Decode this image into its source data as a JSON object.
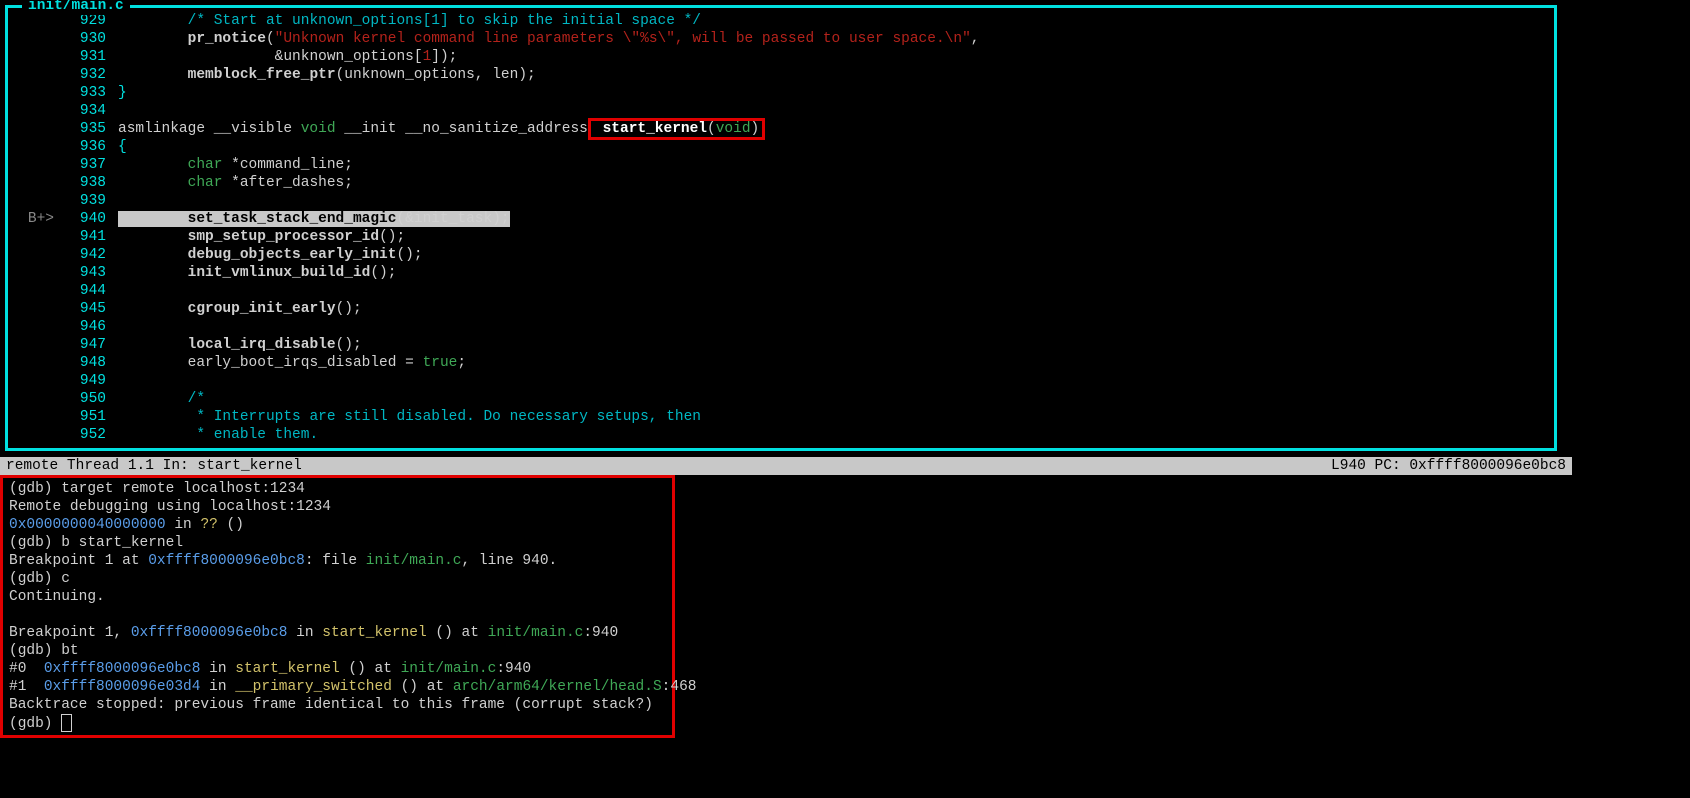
{
  "frame_title": "init/main.c",
  "src": [
    {
      "g": "",
      "n": "929",
      "tokens": [
        [
          "sp",
          "        "
        ],
        [
          "cmt",
          "/* Start at unknown_options[1] to skip the initial space */"
        ]
      ]
    },
    {
      "g": "",
      "n": "930",
      "tokens": [
        [
          "sp",
          "        "
        ],
        [
          "fn",
          "pr_notice"
        ],
        [
          "p",
          "("
        ],
        [
          "str",
          "\"Unknown kernel command line parameters \\\"%s\\\", will be passed to user space.\\n\""
        ],
        [
          "p",
          ","
        ]
      ]
    },
    {
      "g": "",
      "n": "931",
      "tokens": [
        [
          "sp",
          "                  "
        ],
        [
          "p",
          "&"
        ],
        [
          "id",
          "unknown_options"
        ],
        [
          "p",
          "["
        ],
        [
          "num",
          "1"
        ],
        [
          "p",
          "]);"
        ]
      ]
    },
    {
      "g": "",
      "n": "932",
      "tokens": [
        [
          "sp",
          "        "
        ],
        [
          "fn",
          "memblock_free_ptr"
        ],
        [
          "p",
          "("
        ],
        [
          "id",
          "unknown_options"
        ],
        [
          "p",
          ", "
        ],
        [
          "id",
          "len"
        ],
        [
          "p",
          ");"
        ]
      ]
    },
    {
      "g": "",
      "n": "933",
      "tokens": [
        [
          "punct",
          "}"
        ]
      ]
    },
    {
      "g": "",
      "n": "934",
      "tokens": []
    },
    {
      "g": "",
      "n": "935",
      "tokens": [
        [
          "id",
          "asmlinkage __visible "
        ],
        [
          "kw",
          "void"
        ],
        [
          "id",
          " __init __no_sanitize_address"
        ],
        [
          "rbs",
          ""
        ],
        [
          "w",
          " start_kernel"
        ],
        [
          "p",
          "("
        ],
        [
          "kw",
          "void"
        ],
        [
          "p",
          ")"
        ],
        [
          "rbe",
          ""
        ]
      ]
    },
    {
      "g": "",
      "n": "936",
      "tokens": [
        [
          "punct",
          "{"
        ]
      ]
    },
    {
      "g": "",
      "n": "937",
      "tokens": [
        [
          "sp",
          "        "
        ],
        [
          "kw",
          "char"
        ],
        [
          "id",
          " *command_line;"
        ]
      ]
    },
    {
      "g": "",
      "n": "938",
      "tokens": [
        [
          "sp",
          "        "
        ],
        [
          "kw",
          "char"
        ],
        [
          "id",
          " *after_dashes;"
        ]
      ]
    },
    {
      "g": "",
      "n": "939",
      "tokens": []
    },
    {
      "g": "B+>",
      "n": "940",
      "hl": true,
      "tokens": [
        [
          "sp",
          "        "
        ],
        [
          "fn",
          "set_task_stack_end_magic"
        ],
        [
          "p",
          "(&"
        ],
        [
          "id",
          "init_task"
        ],
        [
          "p",
          ");"
        ]
      ]
    },
    {
      "g": "",
      "n": "941",
      "tokens": [
        [
          "sp",
          "        "
        ],
        [
          "fn",
          "smp_setup_processor_id"
        ],
        [
          "p",
          "();"
        ]
      ]
    },
    {
      "g": "",
      "n": "942",
      "tokens": [
        [
          "sp",
          "        "
        ],
        [
          "fn",
          "debug_objects_early_init"
        ],
        [
          "p",
          "();"
        ]
      ]
    },
    {
      "g": "",
      "n": "943",
      "tokens": [
        [
          "sp",
          "        "
        ],
        [
          "fn",
          "init_vmlinux_build_id"
        ],
        [
          "p",
          "();"
        ]
      ]
    },
    {
      "g": "",
      "n": "944",
      "tokens": []
    },
    {
      "g": "",
      "n": "945",
      "tokens": [
        [
          "sp",
          "        "
        ],
        [
          "fn",
          "cgroup_init_early"
        ],
        [
          "p",
          "();"
        ]
      ]
    },
    {
      "g": "",
      "n": "946",
      "tokens": []
    },
    {
      "g": "",
      "n": "947",
      "tokens": [
        [
          "sp",
          "        "
        ],
        [
          "fn",
          "local_irq_disable"
        ],
        [
          "p",
          "();"
        ]
      ]
    },
    {
      "g": "",
      "n": "948",
      "tokens": [
        [
          "sp",
          "        "
        ],
        [
          "id",
          "early_boot_irqs_disabled = "
        ],
        [
          "kw",
          "true"
        ],
        [
          "id",
          ";"
        ]
      ]
    },
    {
      "g": "",
      "n": "949",
      "tokens": []
    },
    {
      "g": "",
      "n": "950",
      "tokens": [
        [
          "sp",
          "        "
        ],
        [
          "cmt",
          "/*"
        ]
      ]
    },
    {
      "g": "",
      "n": "951",
      "tokens": [
        [
          "sp",
          "        "
        ],
        [
          "cmt",
          " * Interrupts are still disabled. Do necessary setups, then"
        ]
      ]
    },
    {
      "g": "",
      "n": "952",
      "tokens": [
        [
          "sp",
          "        "
        ],
        [
          "cmt",
          " * enable them."
        ]
      ]
    }
  ],
  "status_left": "remote Thread 1.1 In: start_kernel",
  "status_right": "L940  PC: 0xffff8000096e0bc8",
  "console": [
    [
      [
        "p",
        "(gdb) "
      ],
      [
        "t",
        "target remote localhost:1234"
      ]
    ],
    [
      [
        "t",
        "Remote debugging using localhost:1234"
      ]
    ],
    [
      [
        "a",
        "0x0000000040000000"
      ],
      [
        "t",
        " in "
      ],
      [
        "fn",
        "??"
      ],
      [
        "t",
        " ()"
      ]
    ],
    [
      [
        "p",
        "(gdb) "
      ],
      [
        "t",
        "b start_kernel"
      ]
    ],
    [
      [
        "t",
        "Breakpoint 1 at "
      ],
      [
        "a",
        "0xffff8000096e0bc8"
      ],
      [
        "t",
        ": file "
      ],
      [
        "f",
        "init/main.c"
      ],
      [
        "t",
        ", line 940."
      ]
    ],
    [
      [
        "p",
        "(gdb) "
      ],
      [
        "t",
        "c"
      ]
    ],
    [
      [
        "t",
        "Continuing."
      ]
    ],
    [],
    [
      [
        "t",
        "Breakpoint 1, "
      ],
      [
        "a",
        "0xffff8000096e0bc8"
      ],
      [
        "t",
        " in "
      ],
      [
        "fn",
        "start_kernel"
      ],
      [
        "t",
        " () at "
      ],
      [
        "f",
        "init/main.c"
      ],
      [
        "t",
        ":940"
      ]
    ],
    [
      [
        "p",
        "(gdb) "
      ],
      [
        "t",
        "bt"
      ]
    ],
    [
      [
        "t",
        "#0  "
      ],
      [
        "a",
        "0xffff8000096e0bc8"
      ],
      [
        "t",
        " in "
      ],
      [
        "fn",
        "start_kernel"
      ],
      [
        "t",
        " () at "
      ],
      [
        "f",
        "init/main.c"
      ],
      [
        "t",
        ":940"
      ]
    ],
    [
      [
        "t",
        "#1  "
      ],
      [
        "a",
        "0xffff8000096e03d4"
      ],
      [
        "t",
        " in "
      ],
      [
        "fn",
        "__primary_switched"
      ],
      [
        "t",
        " () at "
      ],
      [
        "f",
        "arch/arm64/kernel/head.S"
      ],
      [
        "t",
        ":468"
      ]
    ],
    [
      [
        "t",
        "Backtrace stopped: previous frame identical to this frame (corrupt stack?)"
      ]
    ],
    [
      [
        "p",
        "(gdb) "
      ],
      [
        "cur",
        ""
      ]
    ]
  ]
}
